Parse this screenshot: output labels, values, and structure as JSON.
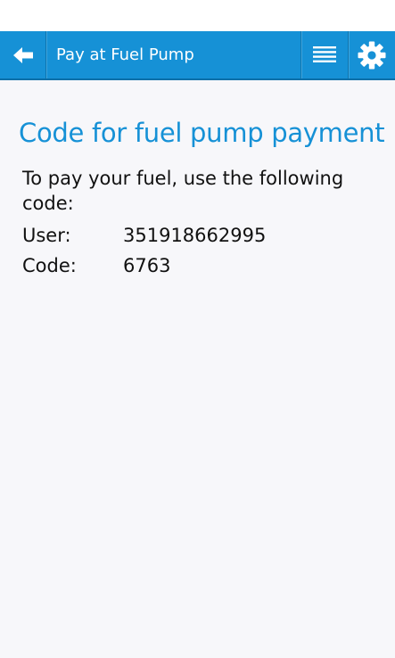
{
  "header": {
    "title": "Pay at Fuel Pump",
    "back_icon": "back-arrow-icon",
    "menu_icon": "list-menu-icon",
    "settings_icon": "gear-icon",
    "accent_color": "#1691d6"
  },
  "main": {
    "heading": "Code for fuel pump payment",
    "instruction": "To pay your fuel, use the following code:",
    "fields": [
      {
        "label": "User:",
        "value": "351918662995"
      },
      {
        "label": "Code:",
        "value": "6763"
      }
    ]
  }
}
